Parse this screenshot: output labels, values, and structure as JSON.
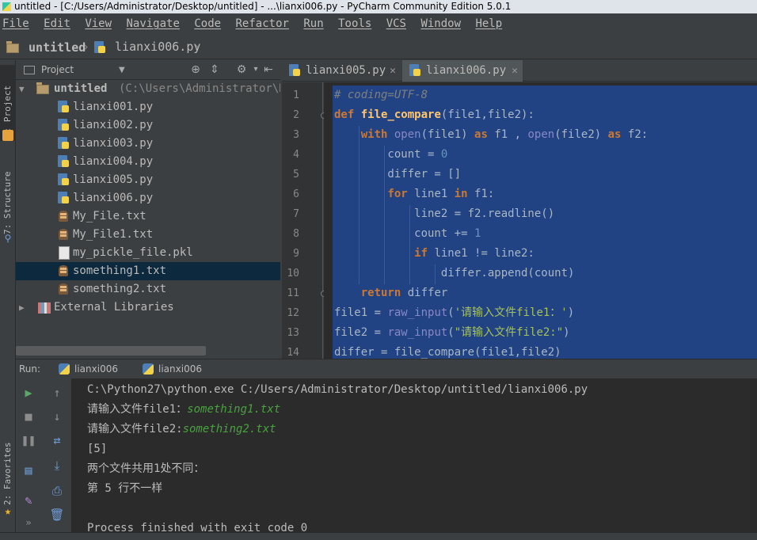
{
  "window": {
    "title": "untitled - [C:/Users/Administrator/Desktop/untitled] - ...\\lianxi006.py - PyCharm Community Edition 5.0.1"
  },
  "menu": [
    "File",
    "Edit",
    "View",
    "Navigate",
    "Code",
    "Refactor",
    "Run",
    "Tools",
    "VCS",
    "Window",
    "Help"
  ],
  "nav": {
    "project": "untitled",
    "file": "lianxi006.py"
  },
  "side_tabs": {
    "project": "1: Project",
    "structure": "7: Structure",
    "favorites": "2: Favorites"
  },
  "project_panel": {
    "title": "Project",
    "root_name": "untitled",
    "root_path": "(C:\\Users\\Administrator\\Desktop\\untitled)",
    "files": [
      {
        "name": "lianxi001.py",
        "kind": "py"
      },
      {
        "name": "lianxi002.py",
        "kind": "py"
      },
      {
        "name": "lianxi003.py",
        "kind": "py"
      },
      {
        "name": "lianxi004.py",
        "kind": "py"
      },
      {
        "name": "lianxi005.py",
        "kind": "py"
      },
      {
        "name": "lianxi006.py",
        "kind": "py"
      },
      {
        "name": "My_File.txt",
        "kind": "txt"
      },
      {
        "name": "My_File1.txt",
        "kind": "txt"
      },
      {
        "name": "my_pickle_file.pkl",
        "kind": "pkl"
      },
      {
        "name": "something1.txt",
        "kind": "txt",
        "selected": true
      },
      {
        "name": "something2.txt",
        "kind": "txt"
      }
    ],
    "external_libraries": "External Libraries"
  },
  "editor": {
    "tabs": [
      {
        "label": "lianxi005.py",
        "active": false
      },
      {
        "label": "lianxi006.py",
        "active": true
      }
    ],
    "line_numbers": [
      "1",
      "2",
      "3",
      "4",
      "5",
      "6",
      "7",
      "8",
      "9",
      "10",
      "11",
      "12",
      "13",
      "14"
    ],
    "code": [
      "# coding=UTF-8",
      "def file_compare(file1,file2):",
      "    with open(file1) as f1 , open(file2) as f2:",
      "        count = 0",
      "        differ = []",
      "        for line1 in f1:",
      "            line2 = f2.readline()",
      "            count += 1",
      "            if line1 != line2:",
      "                differ.append(count)",
      "    return differ",
      "file1 = raw_input('请输入文件file1：')",
      "file2 = raw_input(\"请输入文件file2:\")",
      "differ = file_compare(file1,file2)"
    ]
  },
  "run_panel": {
    "label": "Run:",
    "tabs": [
      "lianxi006",
      "lianxi006"
    ],
    "console": [
      {
        "text": "C:\\Python27\\python.exe C:/Users/Administrator/Desktop/untitled/lianxi006.py",
        "input": ""
      },
      {
        "text": "请输入文件file1：",
        "input": "something1.txt"
      },
      {
        "text": "请输入文件file2:",
        "input": "something2.txt"
      },
      {
        "text": "[5]",
        "input": ""
      },
      {
        "text": "两个文件共用1处不同：",
        "input": ""
      },
      {
        "text": "第 5 行不一样",
        "input": ""
      },
      {
        "text": "",
        "input": ""
      },
      {
        "text": "Process finished with exit code 0",
        "input": ""
      }
    ]
  }
}
